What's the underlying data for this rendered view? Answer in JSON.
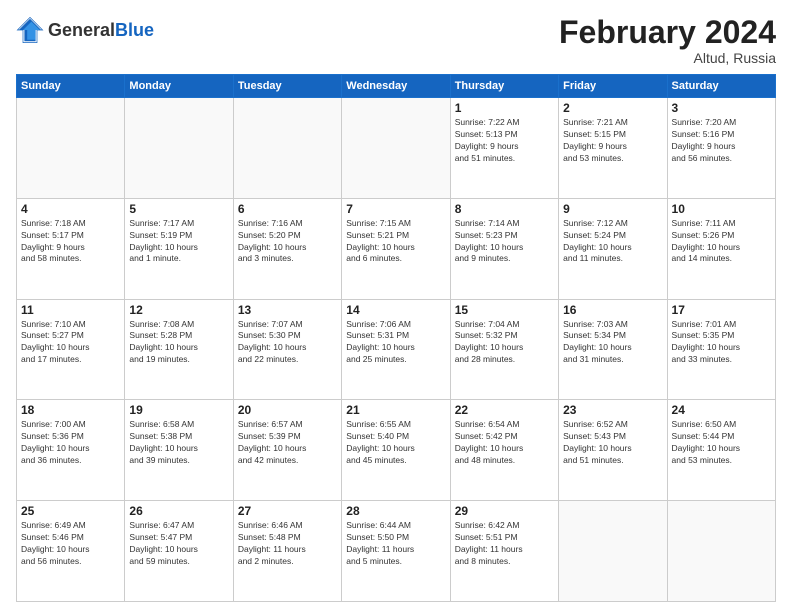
{
  "header": {
    "logo": {
      "general": "General",
      "blue": "Blue"
    },
    "title": "February 2024",
    "location": "Altud, Russia"
  },
  "weekdays": [
    "Sunday",
    "Monday",
    "Tuesday",
    "Wednesday",
    "Thursday",
    "Friday",
    "Saturday"
  ],
  "weeks": [
    [
      {
        "day": "",
        "info": ""
      },
      {
        "day": "",
        "info": ""
      },
      {
        "day": "",
        "info": ""
      },
      {
        "day": "",
        "info": ""
      },
      {
        "day": "1",
        "info": "Sunrise: 7:22 AM\nSunset: 5:13 PM\nDaylight: 9 hours\nand 51 minutes."
      },
      {
        "day": "2",
        "info": "Sunrise: 7:21 AM\nSunset: 5:15 PM\nDaylight: 9 hours\nand 53 minutes."
      },
      {
        "day": "3",
        "info": "Sunrise: 7:20 AM\nSunset: 5:16 PM\nDaylight: 9 hours\nand 56 minutes."
      }
    ],
    [
      {
        "day": "4",
        "info": "Sunrise: 7:18 AM\nSunset: 5:17 PM\nDaylight: 9 hours\nand 58 minutes."
      },
      {
        "day": "5",
        "info": "Sunrise: 7:17 AM\nSunset: 5:19 PM\nDaylight: 10 hours\nand 1 minute."
      },
      {
        "day": "6",
        "info": "Sunrise: 7:16 AM\nSunset: 5:20 PM\nDaylight: 10 hours\nand 3 minutes."
      },
      {
        "day": "7",
        "info": "Sunrise: 7:15 AM\nSunset: 5:21 PM\nDaylight: 10 hours\nand 6 minutes."
      },
      {
        "day": "8",
        "info": "Sunrise: 7:14 AM\nSunset: 5:23 PM\nDaylight: 10 hours\nand 9 minutes."
      },
      {
        "day": "9",
        "info": "Sunrise: 7:12 AM\nSunset: 5:24 PM\nDaylight: 10 hours\nand 11 minutes."
      },
      {
        "day": "10",
        "info": "Sunrise: 7:11 AM\nSunset: 5:26 PM\nDaylight: 10 hours\nand 14 minutes."
      }
    ],
    [
      {
        "day": "11",
        "info": "Sunrise: 7:10 AM\nSunset: 5:27 PM\nDaylight: 10 hours\nand 17 minutes."
      },
      {
        "day": "12",
        "info": "Sunrise: 7:08 AM\nSunset: 5:28 PM\nDaylight: 10 hours\nand 19 minutes."
      },
      {
        "day": "13",
        "info": "Sunrise: 7:07 AM\nSunset: 5:30 PM\nDaylight: 10 hours\nand 22 minutes."
      },
      {
        "day": "14",
        "info": "Sunrise: 7:06 AM\nSunset: 5:31 PM\nDaylight: 10 hours\nand 25 minutes."
      },
      {
        "day": "15",
        "info": "Sunrise: 7:04 AM\nSunset: 5:32 PM\nDaylight: 10 hours\nand 28 minutes."
      },
      {
        "day": "16",
        "info": "Sunrise: 7:03 AM\nSunset: 5:34 PM\nDaylight: 10 hours\nand 31 minutes."
      },
      {
        "day": "17",
        "info": "Sunrise: 7:01 AM\nSunset: 5:35 PM\nDaylight: 10 hours\nand 33 minutes."
      }
    ],
    [
      {
        "day": "18",
        "info": "Sunrise: 7:00 AM\nSunset: 5:36 PM\nDaylight: 10 hours\nand 36 minutes."
      },
      {
        "day": "19",
        "info": "Sunrise: 6:58 AM\nSunset: 5:38 PM\nDaylight: 10 hours\nand 39 minutes."
      },
      {
        "day": "20",
        "info": "Sunrise: 6:57 AM\nSunset: 5:39 PM\nDaylight: 10 hours\nand 42 minutes."
      },
      {
        "day": "21",
        "info": "Sunrise: 6:55 AM\nSunset: 5:40 PM\nDaylight: 10 hours\nand 45 minutes."
      },
      {
        "day": "22",
        "info": "Sunrise: 6:54 AM\nSunset: 5:42 PM\nDaylight: 10 hours\nand 48 minutes."
      },
      {
        "day": "23",
        "info": "Sunrise: 6:52 AM\nSunset: 5:43 PM\nDaylight: 10 hours\nand 51 minutes."
      },
      {
        "day": "24",
        "info": "Sunrise: 6:50 AM\nSunset: 5:44 PM\nDaylight: 10 hours\nand 53 minutes."
      }
    ],
    [
      {
        "day": "25",
        "info": "Sunrise: 6:49 AM\nSunset: 5:46 PM\nDaylight: 10 hours\nand 56 minutes."
      },
      {
        "day": "26",
        "info": "Sunrise: 6:47 AM\nSunset: 5:47 PM\nDaylight: 10 hours\nand 59 minutes."
      },
      {
        "day": "27",
        "info": "Sunrise: 6:46 AM\nSunset: 5:48 PM\nDaylight: 11 hours\nand 2 minutes."
      },
      {
        "day": "28",
        "info": "Sunrise: 6:44 AM\nSunset: 5:50 PM\nDaylight: 11 hours\nand 5 minutes."
      },
      {
        "day": "29",
        "info": "Sunrise: 6:42 AM\nSunset: 5:51 PM\nDaylight: 11 hours\nand 8 minutes."
      },
      {
        "day": "",
        "info": ""
      },
      {
        "day": "",
        "info": ""
      }
    ]
  ]
}
